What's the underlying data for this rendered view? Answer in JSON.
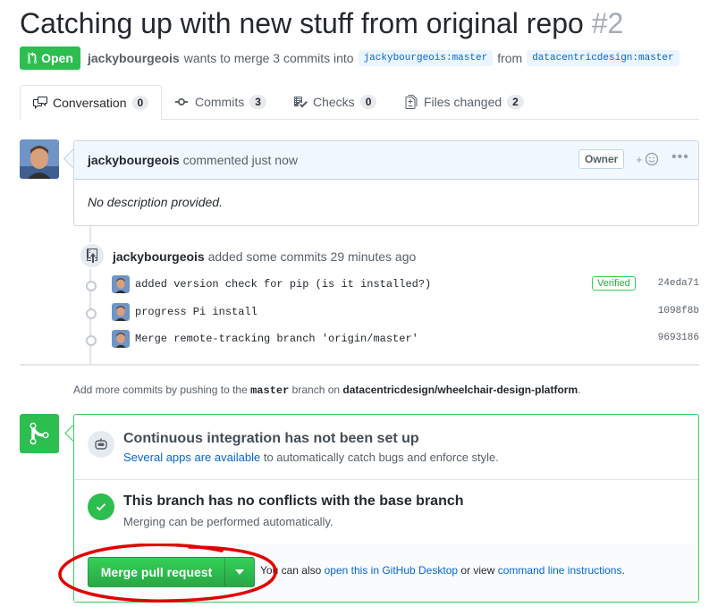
{
  "pr": {
    "title": "Catching up with new stuff from original repo",
    "number": "#2",
    "state": "Open",
    "author": "jackybourgeois",
    "meta_text": "wants to merge 3 commits into",
    "base_branch": "jackybourgeois:master",
    "from_text": "from",
    "head_branch": "datacentricdesign:master"
  },
  "tabs": [
    {
      "label": "Conversation",
      "count": "0",
      "icon": "comment-discussion-icon"
    },
    {
      "label": "Commits",
      "count": "3",
      "icon": "commit-icon"
    },
    {
      "label": "Checks",
      "count": "0",
      "icon": "checklist-icon"
    },
    {
      "label": "Files changed",
      "count": "2",
      "icon": "file-diff-icon"
    }
  ],
  "comment": {
    "author": "jackybourgeois",
    "action": "commented just now",
    "role": "Owner",
    "body": "No description provided."
  },
  "push_event": {
    "author": "jackybourgeois",
    "text": "added some commits 29 minutes ago"
  },
  "commits": [
    {
      "message": "added version check for pip (is it installed?)",
      "sha": "24eda71",
      "verified": "Verified"
    },
    {
      "message": "progress Pi install",
      "sha": "1098f8b",
      "verified": ""
    },
    {
      "message": "Merge remote-tracking branch 'origin/master'",
      "sha": "9693186",
      "verified": ""
    }
  ],
  "add_more": {
    "prefix": "Add more commits by pushing to the",
    "branch": "master",
    "middle": "branch on",
    "repo": "datacentricdesign/wheelchair-design-platform",
    "suffix": "."
  },
  "merge": {
    "ci_title": "Continuous integration has not been set up",
    "ci_link": "Several apps are available",
    "ci_rest": "to automatically catch bugs and enforce style.",
    "conflict_title": "This branch has no conflicts with the base branch",
    "conflict_sub": "Merging can be performed automatically.",
    "button_label": "Merge pull request",
    "footer_prefix": "You can also",
    "footer_link1": "open this in GitHub Desktop",
    "footer_middle": "or view",
    "footer_link2": "command line instructions",
    "footer_suffix": "."
  },
  "colors": {
    "green": "#2cbe4e",
    "link": "#0366d6",
    "annotation": "#e00000"
  }
}
